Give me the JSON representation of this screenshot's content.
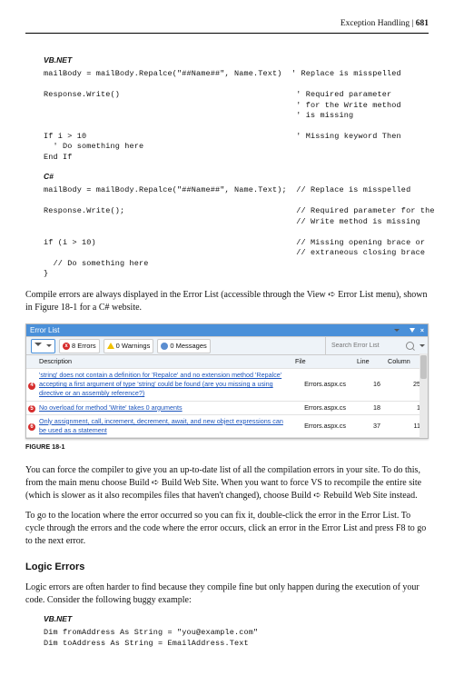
{
  "header": {
    "section": "Exception Handling",
    "sep": " | ",
    "page": "681"
  },
  "langs": {
    "vbnet": "VB.NET",
    "csharp": "C#"
  },
  "code_vbnet": "mailBody = mailBody.Repalce(\"##Name##\", Name.Text)  ' Replace is misspelled\n\nResponse.Write()                                     ' Required parameter\n                                                     ' for the Write method\n                                                     ' is missing\n\nIf i > 10                                            ' Missing keyword Then\n  ' Do something here\nEnd If",
  "code_csharp": "mailBody = mailBody.Repalce(\"##Name##\", Name.Text);  // Replace is misspelled\n\nResponse.Write();                                    // Required parameter for the\n                                                     // Write method is missing\n\nif (i > 10)                                          // Missing opening brace or\n                                                     // extraneous closing brace\n  // Do something here\n}",
  "paras": {
    "p1": "Compile errors are always displayed in the Error List (accessible through the View ➪ Error List menu), shown in Figure 18-1 for a C# website.",
    "p2": "You can force the compiler to give you an up-to-date list of all the compilation errors in your site. To do this, from the main menu choose Build ➪ Build Web Site.  When you want to force VS to recompile the entire site (which is slower as it also recompiles files that haven't changed), choose Build ➪ Rebuild Web Site instead.",
    "p3": "To go to the location where the error occurred so you can fix it, double-click the error in the Error List. To cycle through the errors and the code where the error occurs, click an error in the Error List and press F8 to go to the next error.",
    "p4": "Logic errors are often harder to find because they compile fine but only happen during the execution of your code. Consider the following buggy example:"
  },
  "example2": "Dim fromAddress As String = \"you@example.com\"\nDim toAddress As String = EmailAddress.Text",
  "error_list": {
    "title": "Error List",
    "filters": {
      "errors": "8 Errors",
      "warnings": "0 Warnings",
      "messages": "0 Messages"
    },
    "search_placeholder": "Search Error List",
    "columns": {
      "desc": "Description",
      "file": "File",
      "line": "Line",
      "col": "Column"
    },
    "rows": [
      {
        "n": "4",
        "desc": "'string' does not contain a definition for 'Repalce' and no extension method 'Repalce' accepting a first argument of type 'string' could be found (are you missing a using directive or an assembly reference?)",
        "file": "Errors.aspx.cs",
        "line": "16",
        "col": "25"
      },
      {
        "n": "5",
        "desc": "No overload for method 'Write' takes 0 arguments",
        "file": "Errors.aspx.cs",
        "line": "18",
        "col": "1"
      },
      {
        "n": "6",
        "desc": "Only assignment, call, increment, decrement, await, and new object expressions can be used as a statement",
        "file": "Errors.aspx.cs",
        "line": "37",
        "col": "11"
      }
    ]
  },
  "figure": "FIGURE 18-1",
  "sections": {
    "logic": "Logic Errors"
  }
}
